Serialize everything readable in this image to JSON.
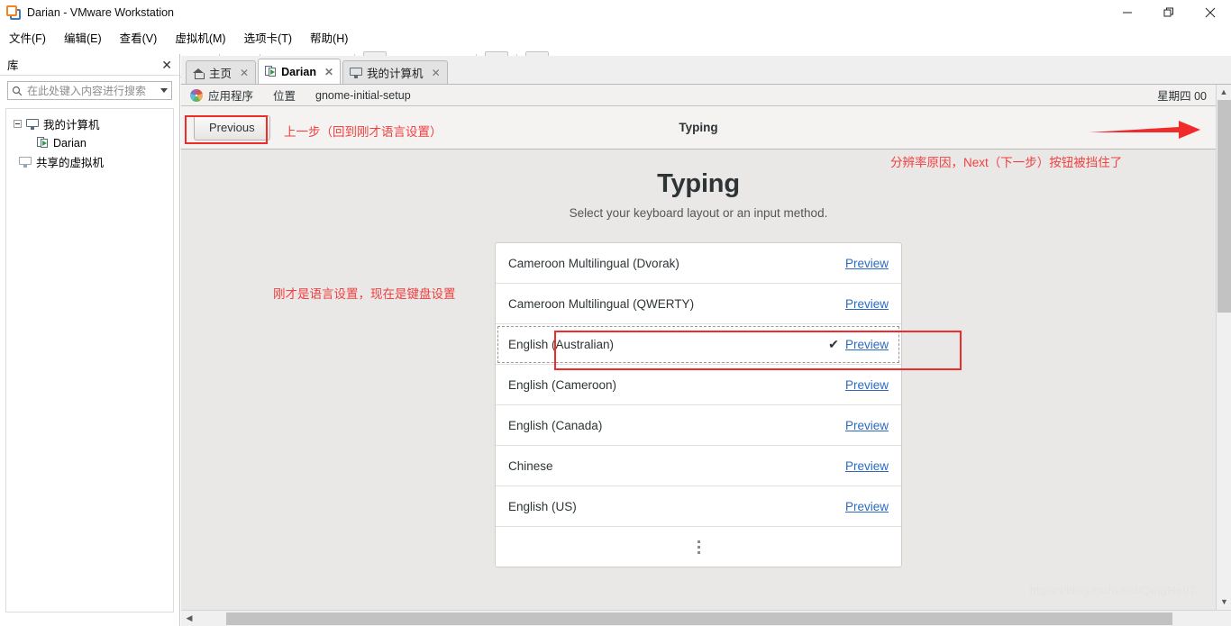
{
  "window": {
    "title": "Darian - VMware Workstation",
    "logo_icon": "vmware-logo-icon",
    "minimize_icon": "minimize-icon",
    "restore_icon": "restore-icon",
    "close_icon": "close-icon"
  },
  "menubar": {
    "items": [
      {
        "label": "文件(F)",
        "name": "menu-file"
      },
      {
        "label": "编辑(E)",
        "name": "menu-edit"
      },
      {
        "label": "查看(V)",
        "name": "menu-view"
      },
      {
        "label": "虚拟机(M)",
        "name": "menu-vm"
      },
      {
        "label": "选项卡(T)",
        "name": "menu-tabs"
      },
      {
        "label": "帮助(H)",
        "name": "menu-help"
      }
    ]
  },
  "toolbar": {
    "buttons": [
      {
        "name": "suspend-button",
        "icon": "pause-icon"
      },
      {
        "name": "power-dropdown-button",
        "icon": "chevron-down-icon"
      },
      {
        "name": "manage-snapshot-button",
        "icon": "snapshot-icon"
      },
      {
        "name": "take-snapshot-button",
        "icon": "snapshot-add-clock-icon"
      },
      {
        "name": "revert-snapshot-button",
        "icon": "snapshot-revert-clock-icon"
      },
      {
        "name": "snapshot-manager-button",
        "icon": "snapshot-manager-clock-icon"
      },
      {
        "name": "show-library-button",
        "icon": "library-panel-icon"
      },
      {
        "name": "show-thumbnail-bar-button",
        "icon": "thumbnail-bar-icon"
      },
      {
        "name": "enter-fullscreen-button",
        "icon": "fullscreen-icon"
      },
      {
        "name": "unity-mode-button",
        "icon": "unity-mode-icon"
      },
      {
        "name": "console-view-button",
        "icon": "console-prompt-icon"
      },
      {
        "name": "stretch-guest-button",
        "icon": "expand-arrows-icon"
      },
      {
        "name": "stretch-dropdown-button",
        "icon": "chevron-down-icon"
      }
    ]
  },
  "sidebar": {
    "title": "库",
    "close_icon": "close-icon",
    "search": {
      "placeholder": "在此处键入内容进行搜索",
      "icon": "search-icon",
      "dropdown_icon": "chevron-down-icon",
      "value": ""
    },
    "tree": [
      {
        "label": "我的计算机",
        "icon": "monitor-icon",
        "level": 0,
        "name": "tree-item-my-computer"
      },
      {
        "label": "Darian",
        "icon": "virtual-machine-running-icon",
        "level": 2,
        "name": "tree-item-darian"
      },
      {
        "label": "共享的虚拟机",
        "icon": "shared-vm-icon",
        "level": 1,
        "name": "tree-item-shared-vms"
      }
    ]
  },
  "tabs": [
    {
      "label": "主页",
      "icon": "home-icon",
      "active": false,
      "name": "tab-home"
    },
    {
      "label": "Darian",
      "icon": "virtual-machine-running-icon",
      "active": true,
      "name": "tab-darian"
    },
    {
      "label": "我的计算机",
      "icon": "monitor-icon",
      "active": false,
      "name": "tab-my-computer"
    }
  ],
  "guest": {
    "gnome_top": {
      "applications": "应用程序",
      "places": "位置",
      "window_title": "gnome-initial-setup",
      "clock": "星期四 00",
      "logo_icon": "gnome-foot-icon"
    },
    "setup_header": {
      "previous_label": "Previous",
      "title": "Typing"
    },
    "page": {
      "heading": "Typing",
      "subheading": "Select your keyboard layout or an input method.",
      "preview_label": "Preview",
      "check_icon": "check-icon",
      "more_icon": "more-vertical-icon",
      "layouts": [
        {
          "name": "Cameroon Multilingual (Dvorak)",
          "selected": false
        },
        {
          "name": "Cameroon Multilingual (QWERTY)",
          "selected": false
        },
        {
          "name": "English (Australian)",
          "selected": true
        },
        {
          "name": "English (Cameroon)",
          "selected": false
        },
        {
          "name": "English (Canada)",
          "selected": false
        },
        {
          "name": "Chinese",
          "selected": false
        },
        {
          "name": "English (US)",
          "selected": false
        }
      ]
    }
  },
  "annotations": {
    "color": "#f04040",
    "previous_note": "上一步（回到刚才语言设置）",
    "next_note": "分辨率原因，Next（下一步）按钮被挡住了",
    "list_note": "刚才是语言设置，现在是键盘设置",
    "arrow_icon": "arrow-right-icon",
    "previous_box": "previous-button-highlight",
    "row_box": "selected-row-highlight"
  },
  "watermark": "https://blog.csdn.net/QingHe97"
}
